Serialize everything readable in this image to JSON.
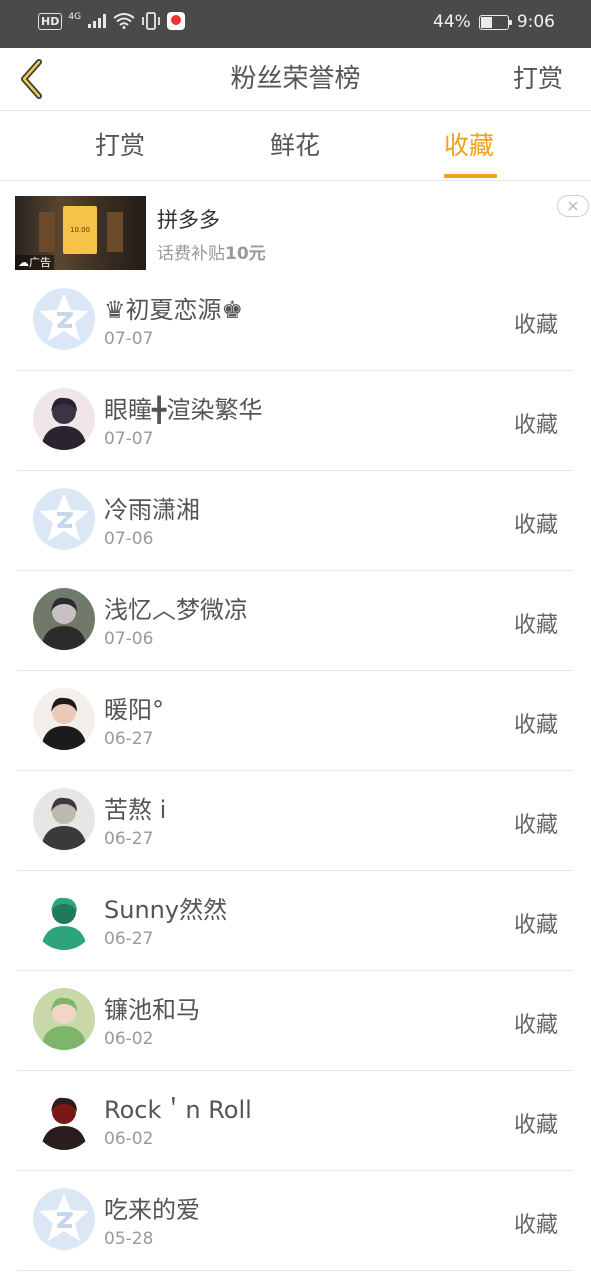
{
  "status_bar": {
    "network_badge": "HD",
    "network_type": "4G",
    "battery_percent_text": "44%",
    "battery_level": 0.44,
    "time": "9:06"
  },
  "header": {
    "title": "粉丝荣誉榜",
    "right_action": "打赏",
    "back_icon": "chevron-left-icon",
    "accent_color": "#f0a21a"
  },
  "tabs": [
    {
      "label": "打赏",
      "active": false
    },
    {
      "label": "鲜花",
      "active": false
    },
    {
      "label": "收藏",
      "active": true
    }
  ],
  "ad": {
    "title": "拼多多",
    "subtitle_prefix": "话费补贴",
    "subtitle_amount": "10元",
    "thumb_text": "10.00",
    "label": "广告",
    "close_icon": "close-icon"
  },
  "list": [
    {
      "name": "♛初夏恋源♚",
      "date": "07-07",
      "action": "收藏",
      "avatar": "default"
    },
    {
      "name": "眼瞳╋渲染繁华",
      "date": "07-07",
      "action": "收藏",
      "avatar": "photo"
    },
    {
      "name": "冷雨潇湘",
      "date": "07-06",
      "action": "收藏",
      "avatar": "default"
    },
    {
      "name": "浅忆︿梦微凉",
      "date": "07-06",
      "action": "收藏",
      "avatar": "photo"
    },
    {
      "name": "暖阳°",
      "date": "06-27",
      "action": "收藏",
      "avatar": "photo"
    },
    {
      "name": "苦熬 i",
      "date": "06-27",
      "action": "收藏",
      "avatar": "photo"
    },
    {
      "name": "Sunny然然",
      "date": "06-27",
      "action": "收藏",
      "avatar": "photo"
    },
    {
      "name": "镰池和马",
      "date": "06-02",
      "action": "收藏",
      "avatar": "photo"
    },
    {
      "name": "Rock＇n Roll",
      "date": "06-02",
      "action": "收藏",
      "avatar": "photo"
    },
    {
      "name": "吃来的爱",
      "date": "05-28",
      "action": "收藏",
      "avatar": "default"
    }
  ]
}
